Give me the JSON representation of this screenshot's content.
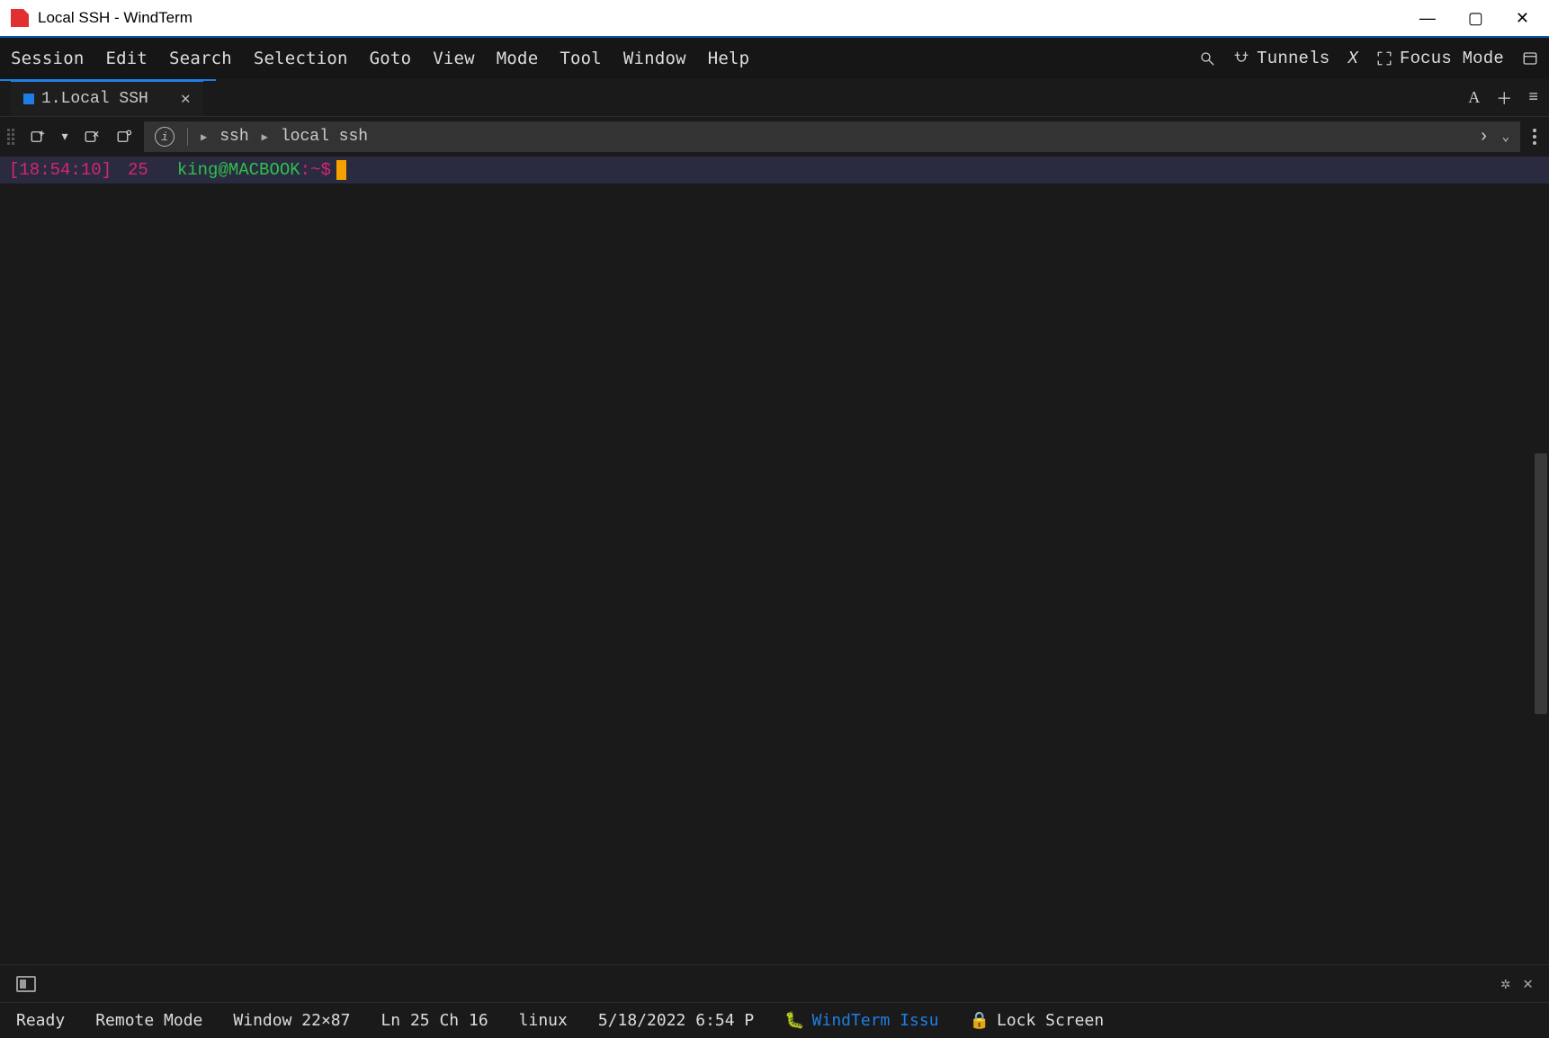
{
  "window": {
    "title": "Local SSH - WindTerm"
  },
  "menu": {
    "items": [
      "Session",
      "Edit",
      "Search",
      "Selection",
      "Goto",
      "View",
      "Mode",
      "Tool",
      "Window",
      "Help"
    ],
    "actions": {
      "tunnels": "Tunnels",
      "focus_mode": "Focus Mode"
    }
  },
  "tab": {
    "label": "1.Local SSH"
  },
  "address": {
    "crumb1": "ssh",
    "crumb2": "local ssh"
  },
  "terminal": {
    "timestamp": "[18:54:10]",
    "lineno": "25",
    "user_host": "king@MACBOOK",
    "path_prompt": ":~$"
  },
  "status": {
    "ready": "Ready",
    "remote": "Remote Mode",
    "winsize": "Window 22×87",
    "pos": "Ln 25 Ch 16",
    "os": "linux",
    "datetime": "5/18/2022 6:54 P",
    "issue_link": "WindTerm Issu",
    "lock": "Lock Screen"
  }
}
